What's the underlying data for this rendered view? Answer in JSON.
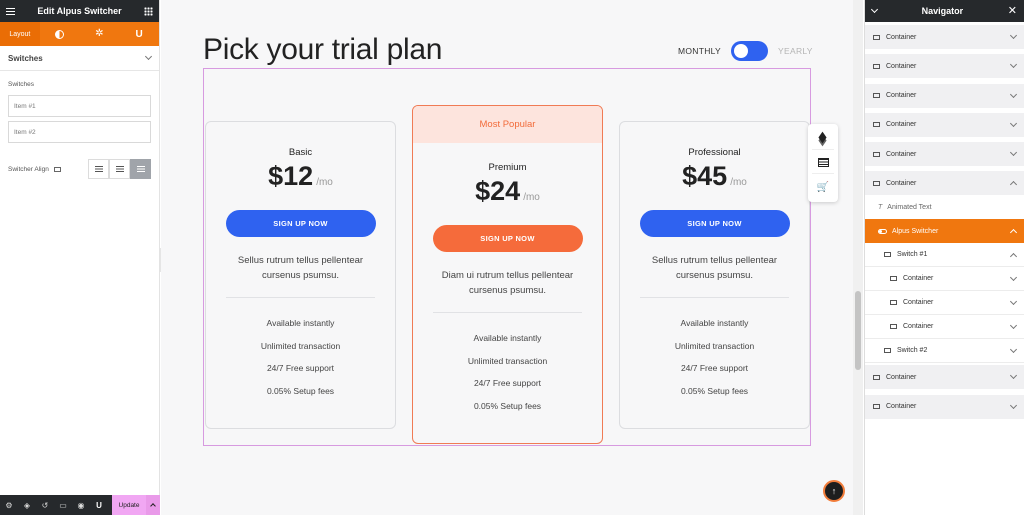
{
  "editor": {
    "title": "Edit Alpus Switcher",
    "tabs": [
      {
        "label": "Layout",
        "icon": "layout-tab"
      },
      {
        "label": "",
        "icon": "style-contrast-icon"
      },
      {
        "label": "",
        "icon": "advanced-gear-icon"
      },
      {
        "label": "",
        "icon": "alpus-u-icon",
        "glyph": "U"
      }
    ],
    "section_title": "Switches",
    "switches_label": "Switches",
    "items": [
      "Item #1",
      "Item #2"
    ],
    "align_label": "Switcher Align",
    "bottom_bar": {
      "update_label": "Update",
      "u_glyph": "U"
    }
  },
  "canvas": {
    "title": "Pick your trial plan",
    "billing": {
      "monthly": "MONTHLY",
      "yearly": "YEARLY",
      "state": "monthly"
    },
    "plans": [
      {
        "name": "Basic",
        "price": "$12",
        "period": "/mo",
        "cta": "SIGN UP NOW",
        "desc": "Sellus rutrum tellus pellentear cursenus psumsu.",
        "features": [
          "Available instantly",
          "Unlimited transaction",
          "24/7 Free support",
          "0.05% Setup fees"
        ]
      },
      {
        "ribbon": "Most Popular",
        "name": "Premium",
        "price": "$24",
        "period": "/mo",
        "cta": "SIGN UP NOW",
        "desc": "Diam ui rutrum tellus pellentear cursenus psumsu.",
        "features": [
          "Available instantly",
          "Unlimited transaction",
          "24/7 Free support",
          "0.05% Setup fees"
        ]
      },
      {
        "name": "Professional",
        "price": "$45",
        "period": "/mo",
        "cta": "SIGN UP NOW",
        "desc": "Sellus rutrum tellus pellentear cursenus psumsu.",
        "features": [
          "Available instantly",
          "Unlimited transaction",
          "24/7 Free support",
          "0.05% Setup fees"
        ]
      }
    ],
    "scroll_top_glyph": "↑",
    "colors": {
      "primary": "#2f62f0",
      "accent": "#f56b3b",
      "editor_orange": "#f0770f"
    }
  },
  "navigator": {
    "title": "Navigator",
    "items": [
      {
        "label": "Container",
        "type": "container"
      },
      {
        "label": "Container",
        "type": "container"
      },
      {
        "label": "Container",
        "type": "container"
      },
      {
        "label": "Container",
        "type": "container"
      },
      {
        "label": "Container",
        "type": "container"
      },
      {
        "label": "Container",
        "type": "container",
        "expanded": true
      },
      {
        "label": "Animated Text",
        "type": "widget"
      },
      {
        "label": "Alpus Switcher",
        "type": "widget",
        "active": true
      },
      {
        "label": "Switch #1",
        "type": "child"
      },
      {
        "label": "Container",
        "type": "child"
      },
      {
        "label": "Container",
        "type": "child"
      },
      {
        "label": "Container",
        "type": "child"
      },
      {
        "label": "Switch #2",
        "type": "child"
      },
      {
        "label": "Container",
        "type": "container"
      },
      {
        "label": "Container",
        "type": "container"
      }
    ]
  }
}
